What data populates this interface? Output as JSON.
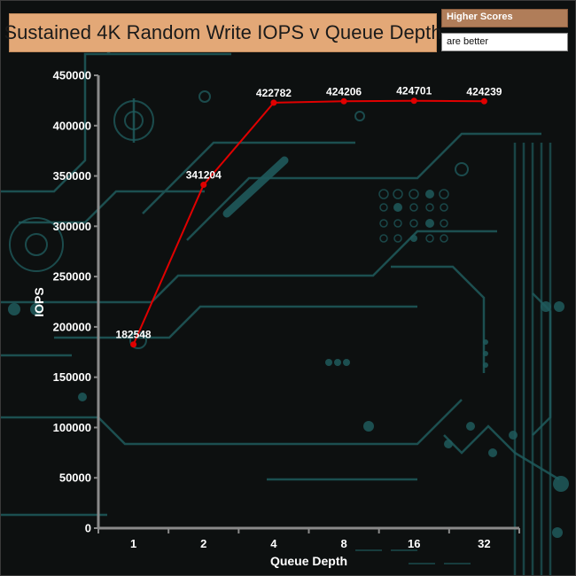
{
  "header": {
    "title": "Sustained 4K Random Write IOPS v Queue Depth",
    "badge_top": "Higher Scores",
    "badge_bottom": "are better"
  },
  "colors": {
    "background": "#0d1010",
    "circuit": "#1f5a5c",
    "line": "#e00000",
    "axis": "#8a8a8a",
    "text": "#ffffff",
    "title_bg": "#e3a877"
  },
  "chart_data": {
    "type": "line",
    "title": "Sustained 4K Random Write IOPS v Queue Depth",
    "xlabel": "Queue Depth",
    "ylabel": "IOPS",
    "categories": [
      "1",
      "2",
      "4",
      "8",
      "16",
      "32"
    ],
    "series": [
      {
        "values": [
          182548,
          341204,
          422782,
          424206,
          424701,
          424239
        ]
      }
    ],
    "data_labels": [
      "182548",
      "341204",
      "422782",
      "424206",
      "424701",
      "424239"
    ],
    "ylim": [
      0,
      450000
    ],
    "yticks": [
      0,
      50000,
      100000,
      150000,
      200000,
      250000,
      300000,
      350000,
      400000,
      450000
    ],
    "grid": false,
    "legend": "none"
  }
}
